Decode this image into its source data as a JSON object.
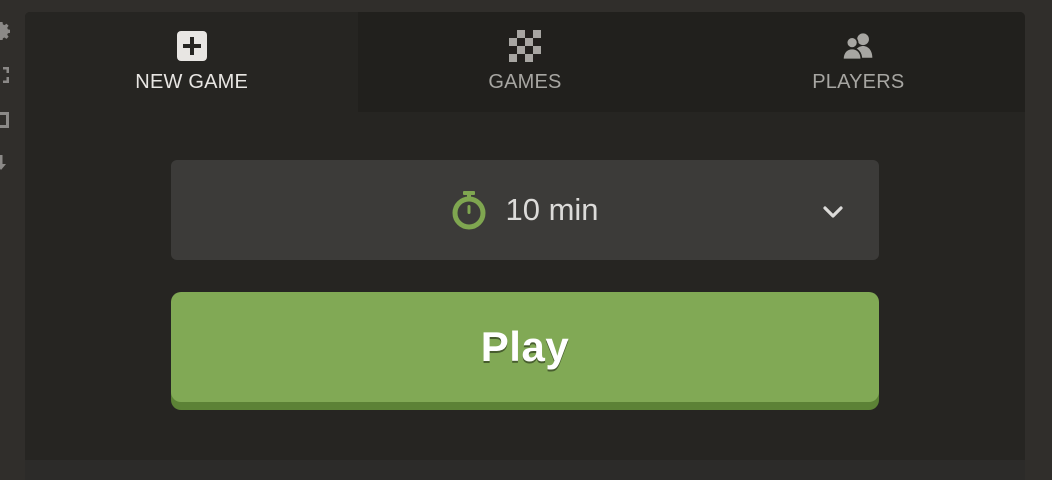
{
  "tabs": [
    {
      "label": "NEW GAME",
      "icon": "plus-square-icon",
      "active": true
    },
    {
      "label": "GAMES",
      "icon": "checkerboard-icon",
      "active": false
    },
    {
      "label": "PLAYERS",
      "icon": "players-icon",
      "active": false
    }
  ],
  "time_control": {
    "label": "10 min",
    "icon": "stopwatch-icon"
  },
  "play_button": {
    "label": "Play"
  },
  "left_rail": {
    "icons": [
      "gear-icon",
      "expand-icon",
      "square-icon",
      "download-icon"
    ]
  },
  "colors": {
    "accent_green": "#81a955",
    "accent_green_dark": "#5c8236",
    "stopwatch_green": "#7fa650",
    "panel_bg": "#262522",
    "page_bg": "#302e2b"
  }
}
